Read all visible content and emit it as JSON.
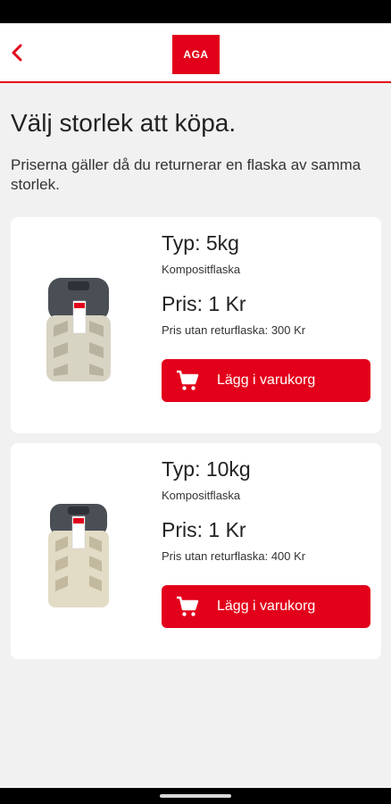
{
  "app": {
    "logo_text": "AGA",
    "brand_color": "#e2001a"
  },
  "header": {
    "back_icon": "chevron-left-icon"
  },
  "page": {
    "title": "Välj storlek att köpa.",
    "subtitle": "Priserna gäller då du returnerar en flaska av samma storlek."
  },
  "products": [
    {
      "type": "Typ: 5kg",
      "kind": "Kompositflaska",
      "price": "Pris: 1 Kr",
      "price_note": "Pris utan returflaska: 300 Kr",
      "button_label": "Lägg i varukorg",
      "icon": "shopping-cart-icon"
    },
    {
      "type": "Typ: 10kg",
      "kind": "Kompositflaska",
      "price": "Pris: 1 Kr",
      "price_note": "Pris utan returflaska: 400 Kr",
      "button_label": "Lägg i varukorg",
      "icon": "shopping-cart-icon"
    }
  ]
}
